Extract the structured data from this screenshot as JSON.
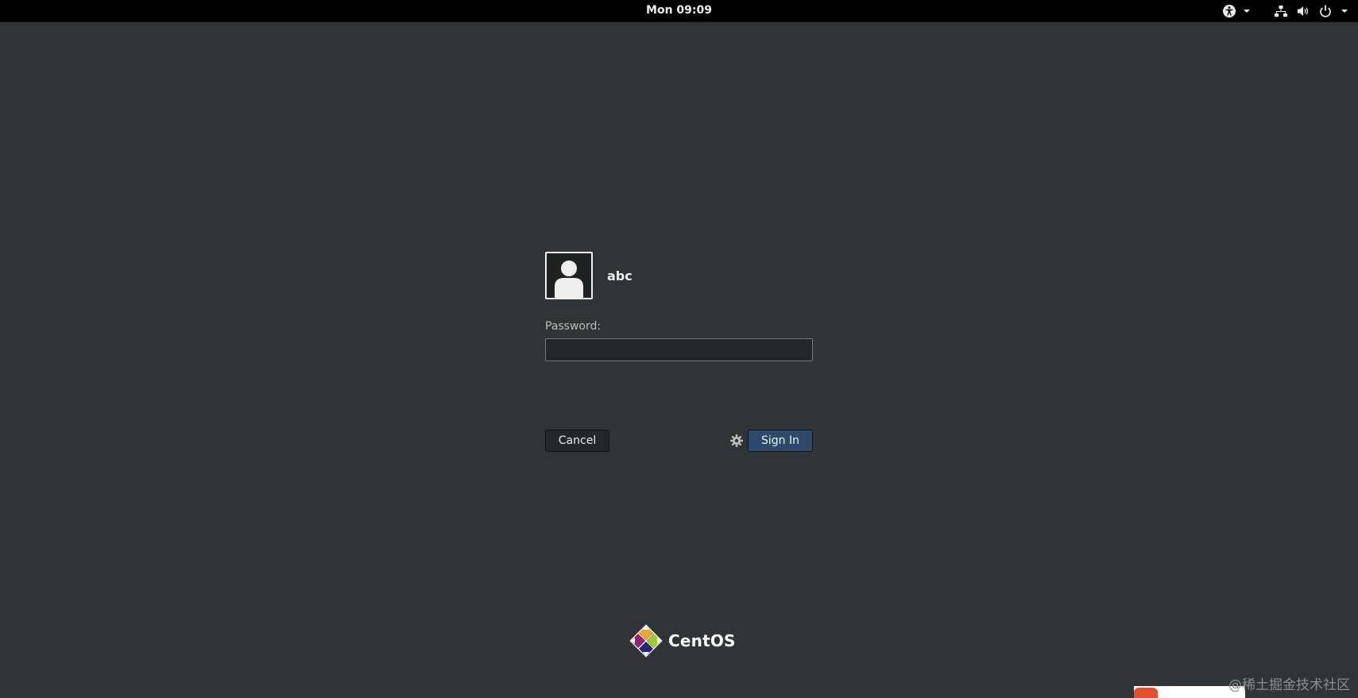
{
  "topbar": {
    "clock": "Mon 09:09",
    "icons": [
      "accessibility-icon",
      "network-icon",
      "volume-icon",
      "power-icon"
    ]
  },
  "login": {
    "username": "abc",
    "password_label": "Password:",
    "password_value": "",
    "cancel_label": "Cancel",
    "signin_label": "Sign In"
  },
  "branding": {
    "name": "CentOS"
  },
  "watermark": "@稀土掘金技术社区",
  "colors": {
    "background": "#2f3537",
    "topbar": "#000000",
    "signin_button": "#2d4a6c",
    "text": "#eeeeec"
  }
}
